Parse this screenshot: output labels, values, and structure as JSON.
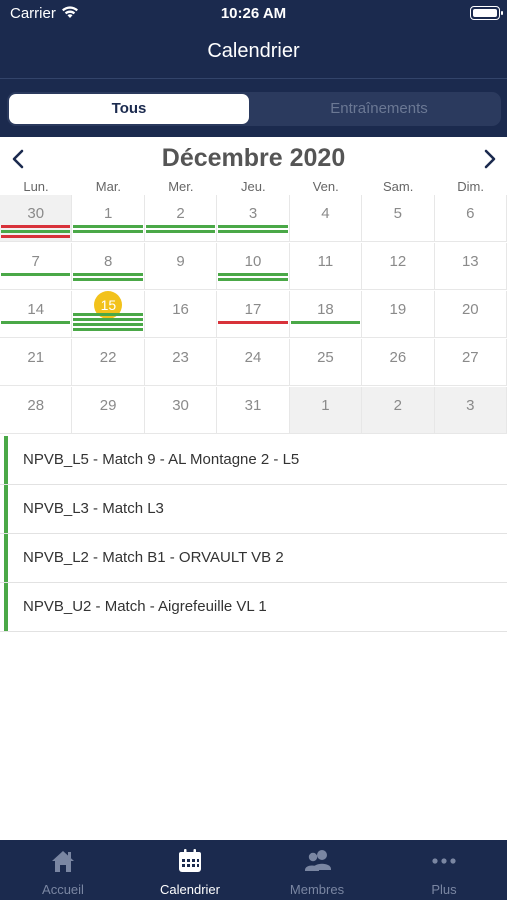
{
  "status_bar": {
    "carrier": "Carrier",
    "time": "10:26 AM"
  },
  "header": {
    "title": "Calendrier"
  },
  "segments": {
    "active": "Tous",
    "inactive": "Entraînements"
  },
  "calendar": {
    "month_title": "Décembre 2020",
    "weekdays": [
      "Lun.",
      "Mar.",
      "Mer.",
      "Jeu.",
      "Ven.",
      "Sam.",
      "Dim."
    ],
    "days": [
      {
        "label": "30",
        "other_month": true,
        "bars": [
          "red",
          "green",
          "red"
        ]
      },
      {
        "label": "1",
        "bars": [
          "green",
          "green"
        ]
      },
      {
        "label": "2",
        "bars": [
          "green",
          "green"
        ]
      },
      {
        "label": "3",
        "bars": [
          "green",
          "green"
        ]
      },
      {
        "label": "4",
        "bars": []
      },
      {
        "label": "5",
        "bars": []
      },
      {
        "label": "6",
        "bars": []
      },
      {
        "label": "7",
        "bars": [
          "green"
        ]
      },
      {
        "label": "8",
        "bars": [
          "green",
          "green"
        ]
      },
      {
        "label": "9",
        "bars": []
      },
      {
        "label": "10",
        "bars": [
          "green",
          "green"
        ]
      },
      {
        "label": "11",
        "bars": []
      },
      {
        "label": "12",
        "bars": []
      },
      {
        "label": "13",
        "bars": []
      },
      {
        "label": "14",
        "bars": [
          "green"
        ]
      },
      {
        "label": "15",
        "today": true,
        "bars": [
          "green",
          "green",
          "green",
          "green"
        ]
      },
      {
        "label": "16",
        "bars": []
      },
      {
        "label": "17",
        "bars": [
          "red"
        ]
      },
      {
        "label": "18",
        "bars": [
          "green"
        ]
      },
      {
        "label": "19",
        "bars": []
      },
      {
        "label": "20",
        "bars": []
      },
      {
        "label": "21",
        "bars": []
      },
      {
        "label": "22",
        "bars": []
      },
      {
        "label": "23",
        "bars": []
      },
      {
        "label": "24",
        "bars": []
      },
      {
        "label": "25",
        "bars": []
      },
      {
        "label": "26",
        "bars": []
      },
      {
        "label": "27",
        "bars": []
      },
      {
        "label": "28",
        "bars": []
      },
      {
        "label": "29",
        "bars": []
      },
      {
        "label": "30",
        "bars": []
      },
      {
        "label": "31",
        "bars": []
      },
      {
        "label": "1",
        "other_month": true,
        "bars": []
      },
      {
        "label": "2",
        "other_month": true,
        "bars": []
      },
      {
        "label": "3",
        "other_month": true,
        "bars": []
      }
    ]
  },
  "events": [
    {
      "label": "NPVB_L5 - Match 9 - AL Montagne 2 - L5"
    },
    {
      "label": "NPVB_L3 - Match L3"
    },
    {
      "label": "NPVB_L2 - Match B1 - ORVAULT VB 2"
    },
    {
      "label": "NPVB_U2 - Match - Aigrefeuille VL 1"
    }
  ],
  "tabs": [
    {
      "label": "Accueil",
      "icon": "home-icon",
      "active": false
    },
    {
      "label": "Calendrier",
      "icon": "calendar-icon",
      "active": true
    },
    {
      "label": "Membres",
      "icon": "members-icon",
      "active": false
    },
    {
      "label": "Plus",
      "icon": "more-icon",
      "active": false
    }
  ],
  "colors": {
    "navy": "#1b2a4e",
    "event_green": "#4aa847",
    "event_red": "#d8323a",
    "today_yellow": "#f2c21b"
  }
}
